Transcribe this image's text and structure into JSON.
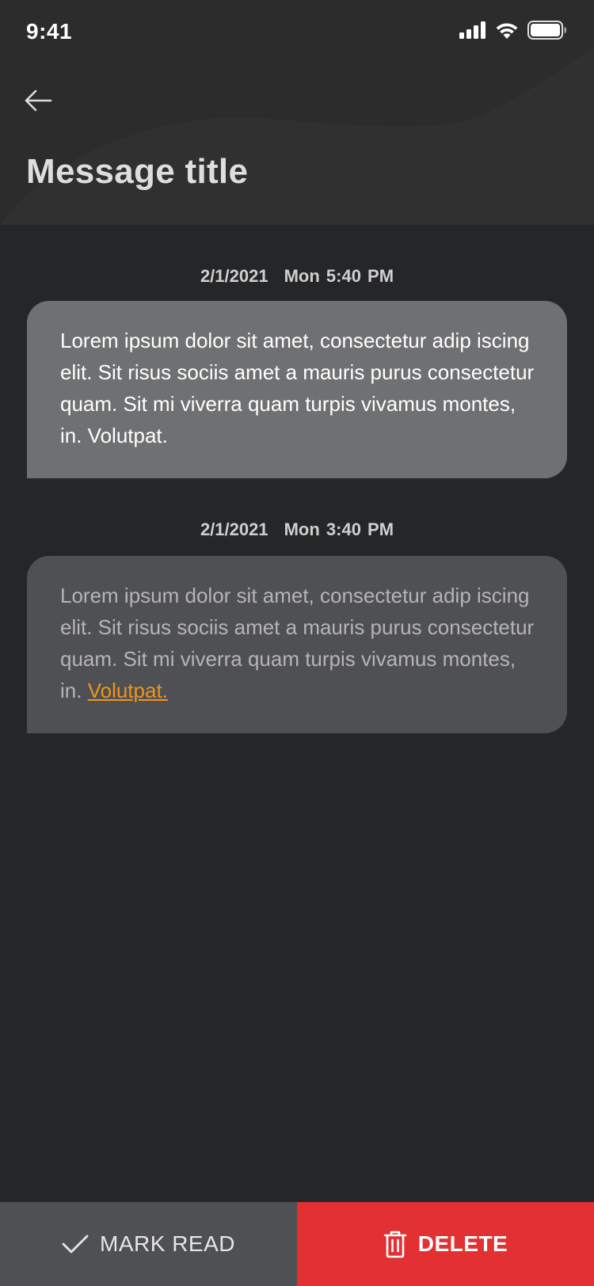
{
  "status_bar": {
    "time": "9:41",
    "icons": [
      "signal-icon",
      "wifi-icon",
      "battery-icon"
    ]
  },
  "header": {
    "back_icon": "arrow-left-icon",
    "title": "Message title"
  },
  "messages": [
    {
      "date": "2/1/2021",
      "time": "Mon 5:40 PM",
      "text": "Lorem ipsum dolor sit amet, consectetur adip iscing elit. Sit risus sociis amet a mauris purus consectetur quam. Sit mi viverra quam turpis vivamus montes, in. Volutpat.",
      "read": false
    },
    {
      "date": "2/1/2021",
      "time": "Mon 3:40 PM",
      "text": "Lorem ipsum dolor sit amet, consectetur adip iscing elit. Sit risus sociis amet a mauris purus consectetur quam. Sit mi viverra quam turpis vivamus montes, in.",
      "link_text": "Volutpat.",
      "read": true
    }
  ],
  "actions": {
    "mark_read_label": "MARK READ",
    "mark_read_icon": "check-icon",
    "delete_label": "DELETE",
    "delete_icon": "trash-icon"
  },
  "colors": {
    "background": "#252628",
    "header": "#2c2c2d",
    "bubble_unread": "#6f7072",
    "bubble_read": "#4f5053",
    "link": "#f0951a",
    "delete": "#e33033"
  }
}
